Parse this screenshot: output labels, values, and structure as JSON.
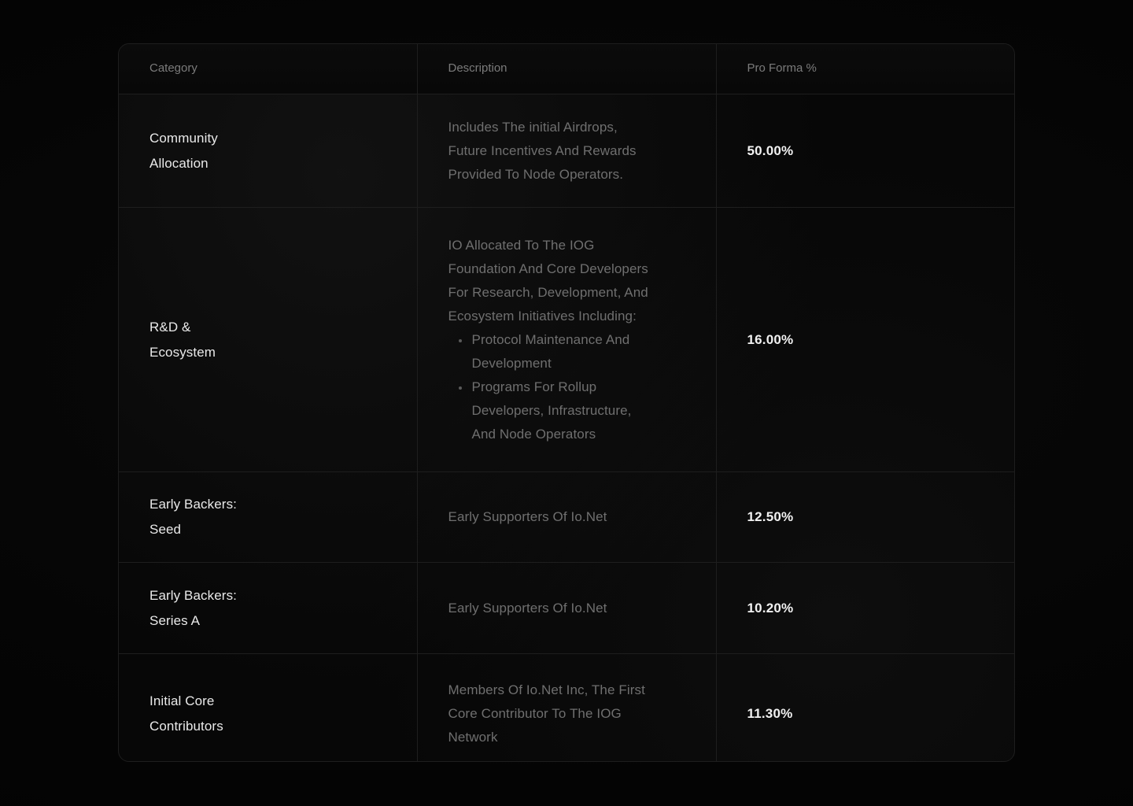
{
  "table": {
    "headers": [
      "Category",
      "Description",
      "Pro Forma %"
    ],
    "rows": [
      {
        "category": "Community\nAllocation",
        "description": "Includes The initial Airdrops,\nFuture Incentives And Rewards\nProvided To Node Operators.",
        "bullets": [],
        "value": "50.00%"
      },
      {
        "category": "R&D &\nEcosystem",
        "description": "IO Allocated To The IOG\nFoundation And Core Developers\nFor Research, Development, And\nEcosystem Initiatives Including:",
        "bullets": [
          "Protocol Maintenance And\nDevelopment",
          "Programs For Rollup\nDevelopers, Infrastructure,\nAnd Node Operators"
        ],
        "value": "16.00%"
      },
      {
        "category": "Early Backers:\nSeed",
        "description": "Early Supporters Of Io.Net",
        "bullets": [],
        "value": "12.50%"
      },
      {
        "category": "Early Backers:\nSeries A",
        "description": "Early Supporters Of Io.Net",
        "bullets": [],
        "value": "10.20%"
      },
      {
        "category": "Initial Core\nContributors",
        "description": "Members Of Io.Net Inc, The First\nCore Contributor To The IOG\nNetwork",
        "bullets": [],
        "value": "11.30%"
      }
    ]
  },
  "colors": {
    "page_background": "#040404",
    "table_background": "#070707",
    "border": "#1e1e1e",
    "header_text": "#7b7b7b",
    "category_text": "#e9e9e9",
    "description_text": "#6f6f6f",
    "value_text": "#f1f1f1",
    "bullet": "#5a5a5a"
  }
}
